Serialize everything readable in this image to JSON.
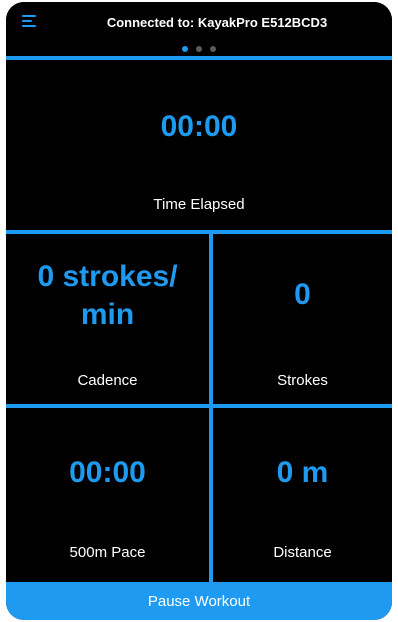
{
  "header": {
    "connection_text": "Connected to: KayakPro E512BCD3",
    "menu_icon": "hamburger-menu-icon",
    "pager": {
      "pages": 3,
      "active_index": 0
    }
  },
  "metrics": {
    "time_elapsed": {
      "value": "00:00",
      "label": "Time Elapsed"
    },
    "cadence": {
      "value_line1": "0 strokes/",
      "value_line2": "min",
      "label": "Cadence"
    },
    "strokes": {
      "value": "0",
      "label": "Strokes"
    },
    "pace": {
      "value": "00:00",
      "label": "500m Pace"
    },
    "distance": {
      "value": "0 m",
      "label": "Distance"
    }
  },
  "footer": {
    "pause_label": "Pause Workout"
  },
  "colors": {
    "accent": "#1e9bf0",
    "background": "#000000",
    "text": "#ffffff"
  }
}
